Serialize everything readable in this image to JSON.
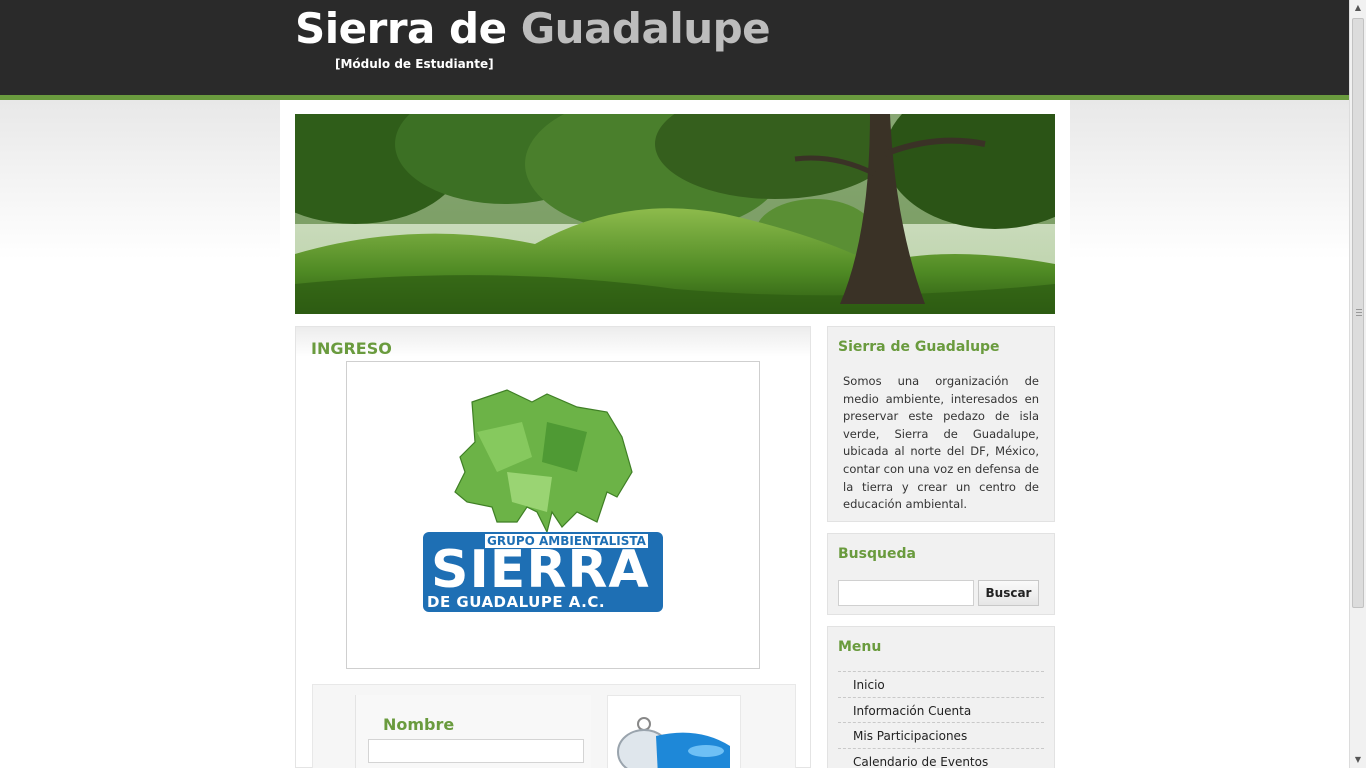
{
  "header": {
    "title_part1": "Sierra de",
    "title_part2": "Guadalupe",
    "subtitle": "[Módulo de Estudiante]"
  },
  "colors": {
    "header_bg": "#2a2a2a",
    "accent_green": "#6a9b3e",
    "title_grey": "#bdbdbd"
  },
  "banner": {
    "icon": "landscape-trees-image"
  },
  "main": {
    "title": "INGRESO",
    "logo": {
      "line1": "GRUPO AMBIENTALISTA",
      "line2": "SIERRA",
      "line3": "DE GUADALUPE A.C."
    },
    "login": {
      "name_label": "Nombre",
      "name_value": "",
      "key_icon": "key-icon"
    }
  },
  "sidebar": {
    "about": {
      "title": "Sierra de Guadalupe",
      "text": "Somos una organización de medio ambiente, interesados en preservar este pedazo de isla verde, Sierra de Guadalupe, ubicada al norte del DF, México, contar con una voz en defensa de la tierra y crear un centro de educación ambiental."
    },
    "search": {
      "title": "Busqueda",
      "input_value": "",
      "button_label": "Buscar"
    },
    "menu": {
      "title": "Menu",
      "items": [
        "Inicio",
        "Información Cuenta",
        "Mis Participaciones",
        "Calendario de Eventos"
      ]
    }
  }
}
